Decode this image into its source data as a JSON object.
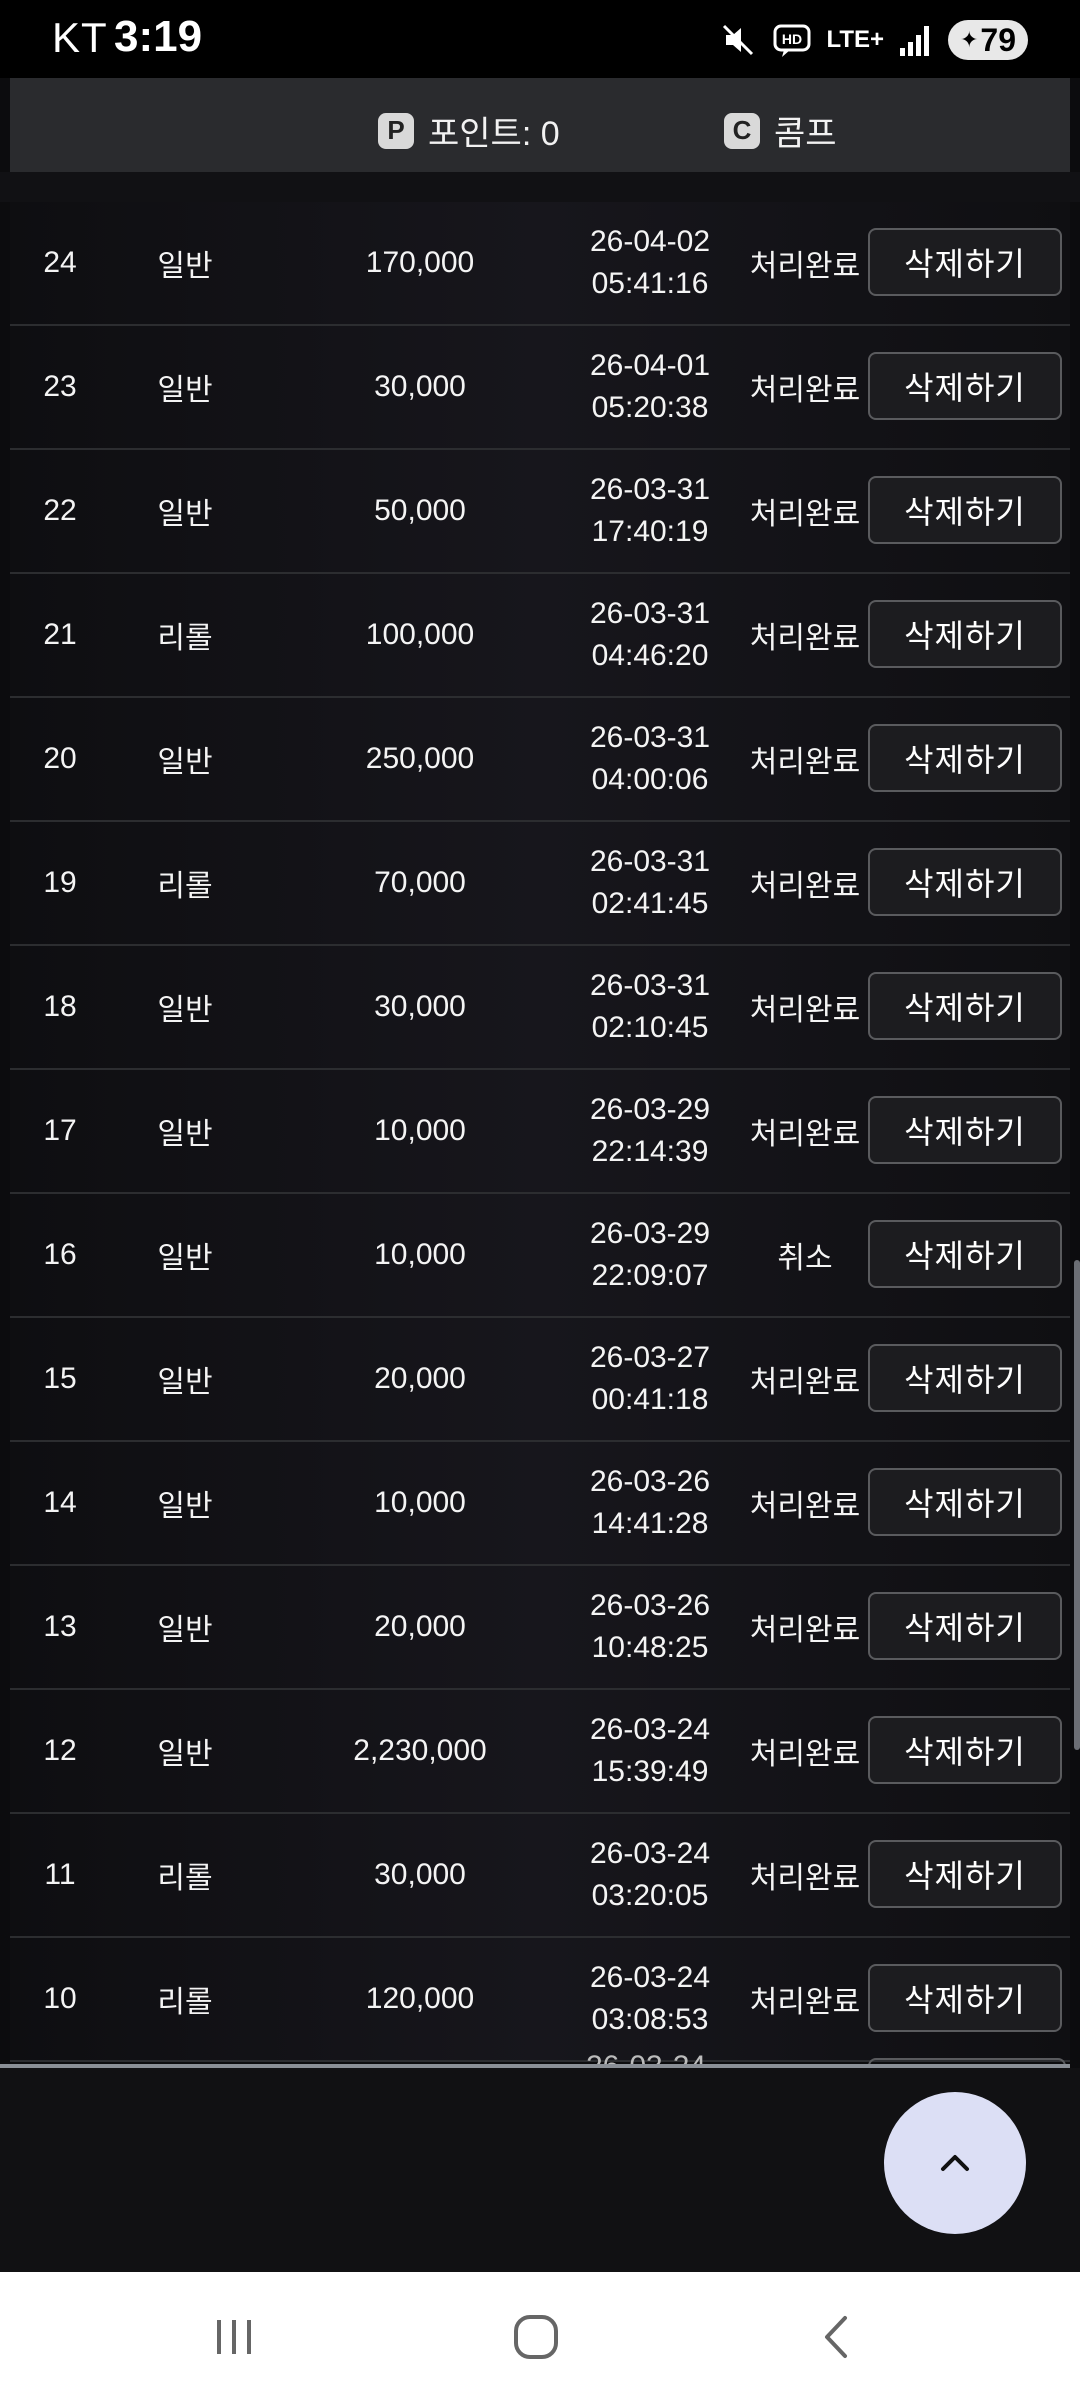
{
  "status_bar": {
    "carrier": "KT",
    "time": "3:19",
    "network": "LTE+",
    "hd": "HD",
    "battery": "79"
  },
  "points_bar": {
    "points_label": "포인트: 0",
    "comp_label": "콤프",
    "points_icon": "P",
    "comp_icon": "C"
  },
  "rows": [
    {
      "num": "24",
      "type": "일반",
      "amount": "170,000",
      "date": "26-04-02",
      "time": "05:41:16",
      "status": "처리완료",
      "action": "삭제하기"
    },
    {
      "num": "23",
      "type": "일반",
      "amount": "30,000",
      "date": "26-04-01",
      "time": "05:20:38",
      "status": "처리완료",
      "action": "삭제하기"
    },
    {
      "num": "22",
      "type": "일반",
      "amount": "50,000",
      "date": "26-03-31",
      "time": "17:40:19",
      "status": "처리완료",
      "action": "삭제하기"
    },
    {
      "num": "21",
      "type": "리롤",
      "amount": "100,000",
      "date": "26-03-31",
      "time": "04:46:20",
      "status": "처리완료",
      "action": "삭제하기"
    },
    {
      "num": "20",
      "type": "일반",
      "amount": "250,000",
      "date": "26-03-31",
      "time": "04:00:06",
      "status": "처리완료",
      "action": "삭제하기"
    },
    {
      "num": "19",
      "type": "리롤",
      "amount": "70,000",
      "date": "26-03-31",
      "time": "02:41:45",
      "status": "처리완료",
      "action": "삭제하기"
    },
    {
      "num": "18",
      "type": "일반",
      "amount": "30,000",
      "date": "26-03-31",
      "time": "02:10:45",
      "status": "처리완료",
      "action": "삭제하기"
    },
    {
      "num": "17",
      "type": "일반",
      "amount": "10,000",
      "date": "26-03-29",
      "time": "22:14:39",
      "status": "처리완료",
      "action": "삭제하기"
    },
    {
      "num": "16",
      "type": "일반",
      "amount": "10,000",
      "date": "26-03-29",
      "time": "22:09:07",
      "status": "취소",
      "action": "삭제하기"
    },
    {
      "num": "15",
      "type": "일반",
      "amount": "20,000",
      "date": "26-03-27",
      "time": "00:41:18",
      "status": "처리완료",
      "action": "삭제하기"
    },
    {
      "num": "14",
      "type": "일반",
      "amount": "10,000",
      "date": "26-03-26",
      "time": "14:41:28",
      "status": "처리완료",
      "action": "삭제하기"
    },
    {
      "num": "13",
      "type": "일반",
      "amount": "20,000",
      "date": "26-03-26",
      "time": "10:48:25",
      "status": "처리완료",
      "action": "삭제하기"
    },
    {
      "num": "12",
      "type": "일반",
      "amount": "2,230,000",
      "date": "26-03-24",
      "time": "15:39:49",
      "status": "처리완료",
      "action": "삭제하기"
    },
    {
      "num": "11",
      "type": "리롤",
      "amount": "30,000",
      "date": "26-03-24",
      "time": "03:20:05",
      "status": "처리완료",
      "action": "삭제하기"
    },
    {
      "num": "10",
      "type": "리롤",
      "amount": "120,000",
      "date": "26-03-24",
      "time": "03:08:53",
      "status": "처리완료",
      "action": "삭제하기"
    }
  ],
  "partial_row_text": "26-03-24",
  "icons": {
    "mute": "mute-icon",
    "signal": "signal-icon",
    "scroll_top": "chevron-up-icon",
    "nav_recent": "recent-apps-icon",
    "nav_home": "home-icon",
    "nav_back": "back-icon"
  },
  "colors": {
    "background": "#0c0c0e",
    "panel": "#2a2b2e",
    "scroll_top_button": "#dcdff5",
    "button_border": "#5a5b5e"
  }
}
